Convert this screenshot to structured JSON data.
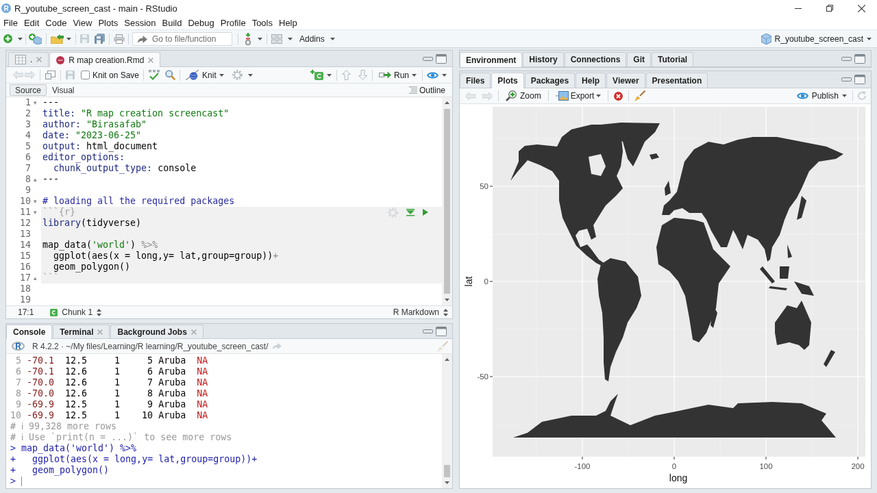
{
  "window": {
    "app_icon_letter": "R",
    "title": "R_youtube_screen_cast - main - RStudio"
  },
  "menu": [
    "File",
    "Edit",
    "Code",
    "View",
    "Plots",
    "Session",
    "Build",
    "Debug",
    "Profile",
    "Tools",
    "Help"
  ],
  "toolbar": {
    "goto_placeholder": "Go to file/function",
    "addins": "Addins",
    "project": "R_youtube_screen_cast"
  },
  "editor": {
    "tabs": [
      {
        "label": ".",
        "kind": "data",
        "selected": false
      },
      {
        "label": "R map creation.Rmd",
        "kind": "rmarkdown",
        "selected": true
      }
    ],
    "toolbar": {
      "knit_on_save": {
        "label": "Knit on Save",
        "checked": false
      },
      "knit": "Knit",
      "run": "Run"
    },
    "modes": [
      {
        "label": "Source",
        "selected": true
      },
      {
        "label": "Visual",
        "selected": false
      }
    ],
    "outline": "Outline",
    "lines": [
      {
        "number": "1",
        "kind": "text",
        "fold": "▾",
        "tokens": [
          {
            "text": "---",
            "kind": "plain"
          }
        ]
      },
      {
        "number": "2",
        "kind": "text",
        "tokens": [
          {
            "text": "title: ",
            "kind": "key"
          },
          {
            "text": "\"R map creation screencast\"",
            "kind": "string"
          }
        ]
      },
      {
        "number": "3",
        "kind": "text",
        "tokens": [
          {
            "text": "author: ",
            "kind": "key"
          },
          {
            "text": "\"Birasafab\"",
            "kind": "string"
          }
        ]
      },
      {
        "number": "4",
        "kind": "text",
        "tokens": [
          {
            "text": "date: ",
            "kind": "key"
          },
          {
            "text": "\"2023-06-25\"",
            "kind": "string"
          }
        ]
      },
      {
        "number": "5",
        "kind": "text",
        "tokens": [
          {
            "text": "output: ",
            "kind": "key"
          },
          {
            "text": "html_document",
            "kind": "plain"
          }
        ]
      },
      {
        "number": "6",
        "kind": "text",
        "tokens": [
          {
            "text": "editor_options:",
            "kind": "key"
          }
        ]
      },
      {
        "number": "7",
        "kind": "text",
        "tokens": [
          {
            "text": "  chunk_output_type: ",
            "kind": "key"
          },
          {
            "text": "console",
            "kind": "plain"
          }
        ]
      },
      {
        "number": "8",
        "kind": "text",
        "fold": "▴",
        "tokens": [
          {
            "text": "---",
            "kind": "plain"
          }
        ]
      },
      {
        "number": "9",
        "kind": "text"
      },
      {
        "number": "10",
        "kind": "text",
        "fold": "▾",
        "tokens": [
          {
            "text": "# loading all the required packages",
            "kind": "header"
          }
        ]
      },
      {
        "number": "11",
        "kind": "chunk_start",
        "fold": "▾",
        "tokens": [
          {
            "text": "```{r}",
            "kind": "fence"
          }
        ]
      },
      {
        "number": "12",
        "kind": "chunk_body",
        "tokens": [
          {
            "text": "library",
            "kind": "function"
          },
          {
            "text": "(tidyverse)",
            "kind": "plain"
          }
        ]
      },
      {
        "number": "13",
        "kind": "chunk_body"
      },
      {
        "number": "14",
        "kind": "chunk_body",
        "tokens": [
          {
            "text": "map_data(",
            "kind": "plain"
          },
          {
            "text": "'world'",
            "kind": "string"
          },
          {
            "text": ") ",
            "kind": "plain"
          },
          {
            "text": "%>%",
            "kind": "operator"
          }
        ]
      },
      {
        "number": "15",
        "kind": "chunk_body",
        "tokens": [
          {
            "text": "  ggplot(aes(x = long,y= lat,group=group))",
            "kind": "plain"
          },
          {
            "text": "+",
            "kind": "operator"
          }
        ]
      },
      {
        "number": "16",
        "kind": "chunk_body",
        "tokens": [
          {
            "text": "  geom_polygon()",
            "kind": "plain"
          }
        ]
      },
      {
        "number": "17",
        "kind": "chunk_end",
        "fold": "▴",
        "tokens": [
          {
            "text": "```",
            "kind": "fence"
          }
        ]
      },
      {
        "number": "18",
        "kind": "text"
      },
      {
        "number": "19",
        "kind": "text"
      }
    ],
    "status": {
      "position": "17:1",
      "chunk": "Chunk 1",
      "file_type": "R Markdown"
    }
  },
  "console": {
    "tabs": [
      {
        "label": "Console",
        "selected": true,
        "closable": false
      },
      {
        "label": "Terminal",
        "selected": false,
        "closable": true
      },
      {
        "label": "Background Jobs",
        "selected": false,
        "closable": true
      }
    ],
    "logo_letter": "R",
    "session": "R 4.2.2 · ~/My files/Learning/R learning/R_youtube_screen_cast/",
    "lines": [
      {
        "kind": "row",
        "cells": [
          "5",
          "-70.1",
          "12.5",
          "1",
          "5",
          "Aruba",
          "NA"
        ]
      },
      {
        "kind": "row",
        "cells": [
          "6",
          "-70.1",
          "12.6",
          "1",
          "6",
          "Aruba",
          "NA"
        ]
      },
      {
        "kind": "row",
        "cells": [
          "7",
          "-70.0",
          "12.6",
          "1",
          "7",
          "Aruba",
          "NA"
        ]
      },
      {
        "kind": "row",
        "cells": [
          "8",
          "-70.0",
          "12.6",
          "1",
          "8",
          "Aruba",
          "NA"
        ]
      },
      {
        "kind": "row",
        "cells": [
          "9",
          "-69.9",
          "12.5",
          "1",
          "9",
          "Aruba",
          "NA"
        ]
      },
      {
        "kind": "row",
        "cells": [
          "10",
          "-69.9",
          "12.5",
          "1",
          "10",
          "Aruba",
          "NA"
        ]
      },
      {
        "kind": "note",
        "text": "# ℹ 99,328 more rows"
      },
      {
        "kind": "note",
        "text": "# ℹ Use `print(n = ...)` to see more rows"
      },
      {
        "kind": "input",
        "text": "> map_data('world') %>%"
      },
      {
        "kind": "input",
        "text": "+   ggplot(aes(x = long,y= lat,group=group))+"
      },
      {
        "kind": "input",
        "text": "+   geom_polygon()"
      },
      {
        "kind": "prompt",
        "text": ">"
      }
    ]
  },
  "environment_pane": {
    "tabs": [
      {
        "label": "Environment",
        "selected": true
      },
      {
        "label": "History",
        "selected": false
      },
      {
        "label": "Connections",
        "selected": false
      },
      {
        "label": "Git",
        "selected": false
      },
      {
        "label": "Tutorial",
        "selected": false
      }
    ]
  },
  "files_pane": {
    "tabs": [
      {
        "label": "Files",
        "selected": false
      },
      {
        "label": "Plots",
        "selected": true
      },
      {
        "label": "Packages",
        "selected": false
      },
      {
        "label": "Help",
        "selected": false
      },
      {
        "label": "Viewer",
        "selected": false
      },
      {
        "label": "Presentation",
        "selected": false
      }
    ],
    "toolbar": {
      "zoom": "Zoom",
      "export": "Export",
      "publish": "Publish"
    },
    "plot": {
      "xlabel": "long",
      "ylabel": "lat",
      "xticks": [
        "-100",
        "0",
        "100",
        "200"
      ],
      "yticks": [
        "50",
        "0",
        "-50"
      ]
    }
  }
}
